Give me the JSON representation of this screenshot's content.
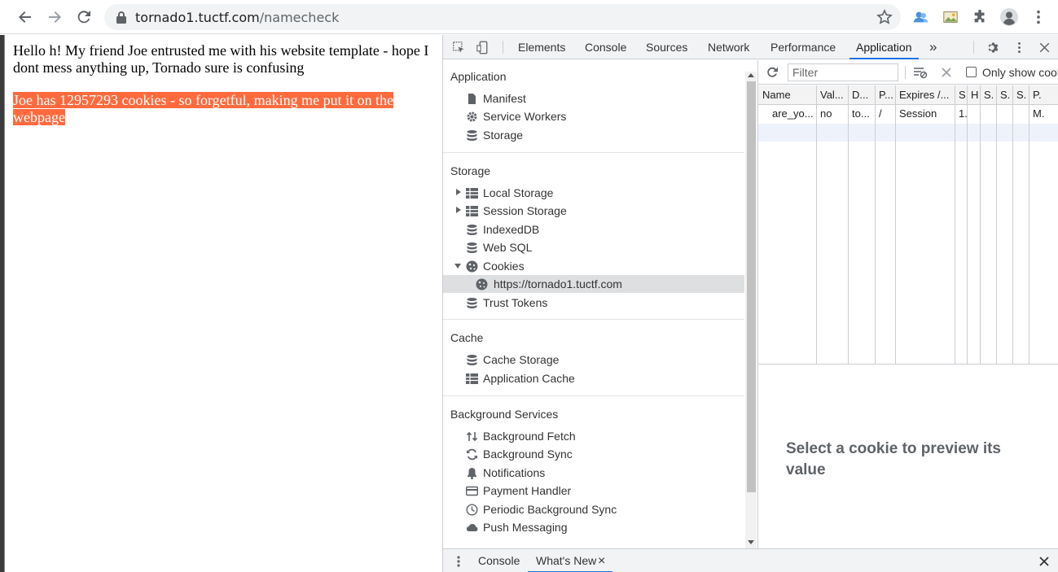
{
  "browser": {
    "url_host": "tornado1.tuctf.com",
    "url_path": "/namecheck"
  },
  "page": {
    "greeting": "Hello h! My friend Joe entrusted me with his website template - hope I dont mess anything up, Tornado sure is confusing",
    "highlight": "Joe has 12957293 cookies - so forgetful, making me put it on the webpage"
  },
  "devtools": {
    "tabs": [
      "Elements",
      "Console",
      "Sources",
      "Network",
      "Performance",
      "Application"
    ],
    "more_tabs": "»",
    "sidebar": {
      "application_header": "Application",
      "application_items": [
        "Manifest",
        "Service Workers",
        "Storage"
      ],
      "storage_header": "Storage",
      "storage_items": [
        "Local Storage",
        "Session Storage",
        "IndexedDB",
        "Web SQL",
        "Cookies",
        "https://tornado1.tuctf.com",
        "Trust Tokens"
      ],
      "cache_header": "Cache",
      "cache_items": [
        "Cache Storage",
        "Application Cache"
      ],
      "bg_header": "Background Services",
      "bg_items": [
        "Background Fetch",
        "Background Sync",
        "Notifications",
        "Payment Handler",
        "Periodic Background Sync",
        "Push Messaging"
      ]
    },
    "filter_placeholder": "Filter",
    "only_show_label": "Only show cook",
    "table": {
      "headers": [
        "Name",
        "Val...",
        "D...",
        "P...",
        "Expires /...",
        "S",
        "H",
        "S.",
        "S.",
        "S.",
        "P."
      ],
      "row": [
        "are_yo...",
        "no",
        "to...",
        "/",
        "Session",
        "1.",
        "",
        "",
        "",
        "",
        "M."
      ]
    },
    "preview_message": "Select a cookie to preview its value",
    "drawer_tabs": [
      "Console",
      "What's New"
    ],
    "close_x": "×"
  }
}
